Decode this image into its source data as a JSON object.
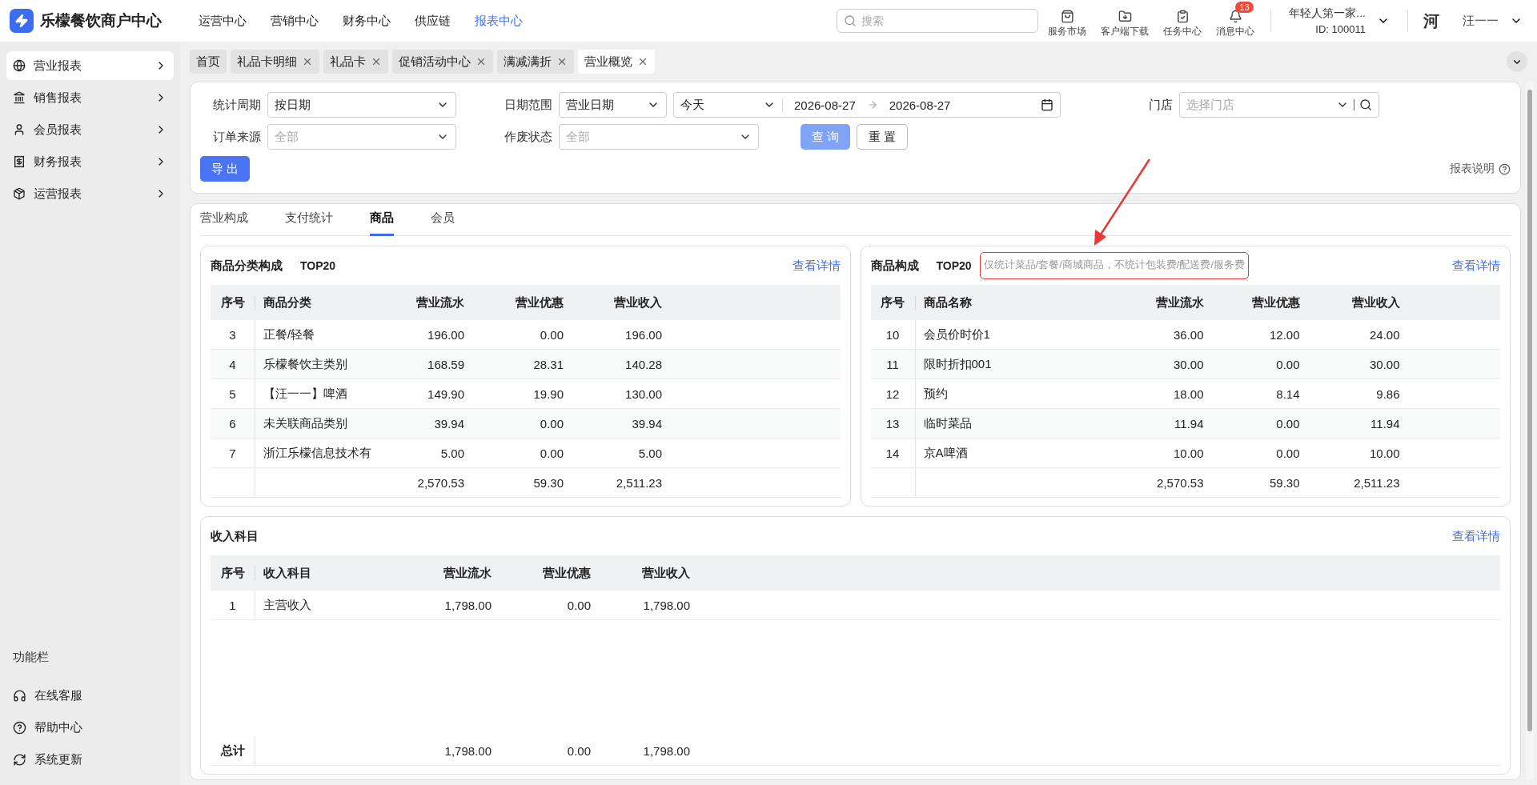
{
  "header": {
    "logo_text": "乐檬餐饮商户中心",
    "nav": [
      {
        "label": "运营中心",
        "selected": false
      },
      {
        "label": "营销中心",
        "selected": false
      },
      {
        "label": "财务中心",
        "selected": false
      },
      {
        "label": "供应链",
        "selected": false
      },
      {
        "label": "报表中心",
        "selected": true
      }
    ],
    "search_placeholder": "搜索",
    "tools": [
      {
        "label": "服务市场"
      },
      {
        "label": "客户端下载"
      },
      {
        "label": "任务中心"
      },
      {
        "label": "消息中心",
        "badge": "13"
      }
    ],
    "account": {
      "name": "年轻人第一家...",
      "id": "ID: 100011"
    },
    "user": {
      "avatar_text": "河",
      "name": "汪一一"
    }
  },
  "sidebar": {
    "items": [
      {
        "label": "营业报表",
        "selected": true
      },
      {
        "label": "销售报表",
        "selected": false
      },
      {
        "label": "会员报表",
        "selected": false
      },
      {
        "label": "财务报表",
        "selected": false
      },
      {
        "label": "运营报表",
        "selected": false
      }
    ],
    "footer_title": "功能栏",
    "footer_items": [
      "在线客服",
      "帮助中心",
      "系统更新"
    ]
  },
  "page_tabs": [
    {
      "label": "首页",
      "closable": false,
      "selected": false
    },
    {
      "label": "礼品卡明细",
      "closable": true,
      "selected": false
    },
    {
      "label": "礼品卡",
      "closable": true,
      "selected": false
    },
    {
      "label": "促销活动中心",
      "closable": true,
      "selected": false
    },
    {
      "label": "满减满折",
      "closable": true,
      "selected": false
    },
    {
      "label": "营业概览",
      "closable": true,
      "selected": true
    }
  ],
  "filters": {
    "period": {
      "label": "统计周期",
      "value": "按日期"
    },
    "date_range": {
      "label": "日期范围",
      "type": "营业日期",
      "preset": "今天",
      "start": "2026-08-27",
      "end": "2026-08-27"
    },
    "store": {
      "label": "门店",
      "placeholder": "选择门店"
    },
    "source": {
      "label": "订单来源",
      "placeholder": "全部"
    },
    "void_status": {
      "label": "作废状态",
      "placeholder": "全部"
    },
    "query_button": "查 询",
    "reset_button": "重 置",
    "export_button": "导 出",
    "help_link": "报表说明"
  },
  "report_tabs": [
    {
      "label": "营业构成",
      "selected": false
    },
    {
      "label": "支付统计",
      "selected": false
    },
    {
      "label": "商品",
      "selected": true
    },
    {
      "label": "会员",
      "selected": false
    }
  ],
  "panels": [
    {
      "title": "商品分类构成",
      "badge": "TOP20",
      "link": "查看详情",
      "columns": [
        "序号",
        "商品分类",
        "营业流水",
        "营业优惠",
        "营业收入"
      ],
      "rows": [
        [
          "3",
          "正餐/轻餐",
          "196.00",
          "0.00",
          "196.00"
        ],
        [
          "4",
          "乐檬餐饮主类别",
          "168.59",
          "28.31",
          "140.28"
        ],
        [
          "5",
          "【汪一一】啤酒",
          "149.90",
          "19.90",
          "130.00"
        ],
        [
          "6",
          "未关联商品类别",
          "39.94",
          "0.00",
          "39.94"
        ],
        [
          "7",
          "浙江乐檬信息技术有",
          "5.00",
          "0.00",
          "5.00"
        ]
      ],
      "total": {
        "values": [
          "2,570.53",
          "59.30",
          "2,511.23"
        ]
      }
    },
    {
      "title": "商品构成",
      "badge": "TOP20",
      "note": "仅统计菜品/套餐/商城商品，不统计包装费/配送费/服务费",
      "link": "查看详情",
      "columns": [
        "序号",
        "商品名称",
        "营业流水",
        "营业优惠",
        "营业收入"
      ],
      "rows": [
        [
          "10",
          "会员价时价1",
          "36.00",
          "12.00",
          "24.00"
        ],
        [
          "11",
          "限时折扣001",
          "30.00",
          "0.00",
          "30.00"
        ],
        [
          "12",
          "预约",
          "18.00",
          "8.14",
          "9.86"
        ],
        [
          "13",
          "临时菜品",
          "11.94",
          "0.00",
          "11.94"
        ],
        [
          "14",
          "京A啤酒",
          "10.00",
          "0.00",
          "10.00"
        ]
      ],
      "total": {
        "values": [
          "2,570.53",
          "59.30",
          "2,511.23"
        ]
      }
    },
    {
      "title": "收入科目",
      "link": "查看详情",
      "columns": [
        "序号",
        "收入科目",
        "营业流水",
        "营业优惠",
        "营业收入"
      ],
      "rows": [
        [
          "1",
          "主营收入",
          "1,798.00",
          "0.00",
          "1,798.00"
        ]
      ],
      "total": {
        "label": "总计",
        "values": [
          "1,798.00",
          "0.00",
          "1,798.00"
        ]
      }
    }
  ]
}
